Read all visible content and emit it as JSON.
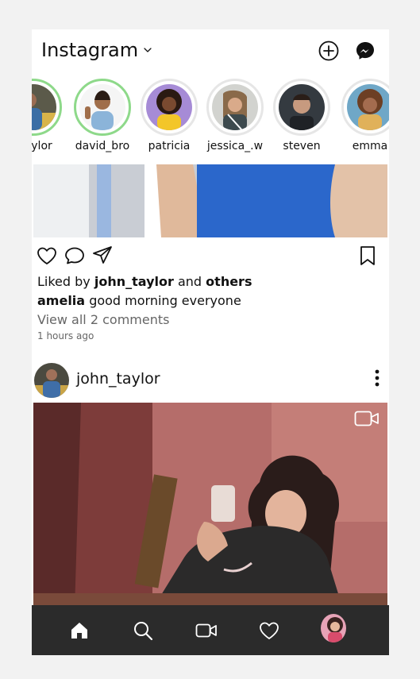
{
  "app": {
    "title": "Instagram"
  },
  "stories": [
    {
      "name": "_taylor",
      "ring": "active"
    },
    {
      "name": "david_bro",
      "ring": "active"
    },
    {
      "name": "patricia",
      "ring": "default"
    },
    {
      "name": "jessica_.w",
      "ring": "default"
    },
    {
      "name": "steven",
      "ring": "default"
    },
    {
      "name": "emma",
      "ring": "default"
    }
  ],
  "post1": {
    "liked_by_prefix": "Liked by",
    "liked_by_user": "john_taylor",
    "liked_by_and": "and",
    "liked_by_others": "others",
    "caption_user": "amelia",
    "caption_text": "good morning everyone",
    "comments_link": "View all 2 comments",
    "time": "1 hours ago"
  },
  "post2": {
    "username": "john_taylor"
  },
  "icons": {
    "top": [
      "new-post-icon",
      "messenger-icon"
    ],
    "actions": [
      "heart-icon",
      "comment-icon",
      "send-icon",
      "bookmark-icon"
    ],
    "bottom_nav": [
      "home-icon",
      "search-icon",
      "reels-icon",
      "activity-icon",
      "profile-avatar"
    ]
  },
  "colors": {
    "story_ring_active": "#8ed98a",
    "story_ring_default": "#e6e6e6",
    "nav_background": "#2b2b2b"
  }
}
